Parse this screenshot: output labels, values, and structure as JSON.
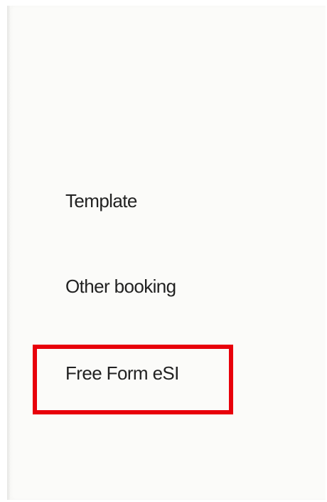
{
  "menu": {
    "items": [
      {
        "label": "Template"
      },
      {
        "label": "Other booking"
      },
      {
        "label": "Free Form eSI"
      }
    ]
  },
  "highlight": {
    "color": "#e8000b",
    "target": "Free Form eSI"
  },
  "colors": {
    "panel_background": "#fbfbf9",
    "text": "#222222"
  }
}
